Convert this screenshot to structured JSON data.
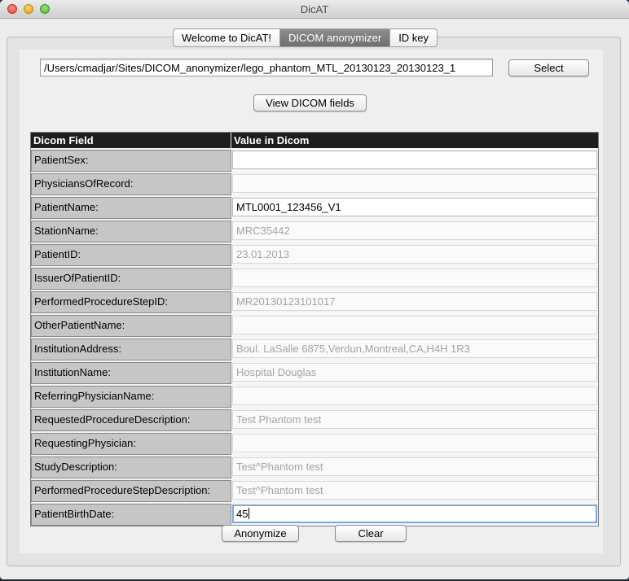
{
  "window": {
    "title": "DicAT"
  },
  "tabs": [
    {
      "label": "Welcome to DicAT!",
      "active": false
    },
    {
      "label": "DICOM anonymizer",
      "active": true
    },
    {
      "label": "ID key",
      "active": false
    }
  ],
  "file": {
    "path": "/Users/cmadjar/Sites/DICOM_anonymizer/lego_phantom_MTL_20130123_20130123_1",
    "select_label": "Select"
  },
  "view_fields_label": "View DICOM fields",
  "table": {
    "headers": [
      "Dicom Field",
      "Value in Dicom"
    ],
    "rows": [
      {
        "field": "PatientSex:",
        "value": "",
        "editable": true
      },
      {
        "field": "PhysiciansOfRecord:",
        "value": "",
        "editable": false
      },
      {
        "field": "PatientName:",
        "value": "MTL0001_123456_V1",
        "editable": true
      },
      {
        "field": "StationName:",
        "value": "MRC35442",
        "editable": false
      },
      {
        "field": "PatientID:",
        "value": "23.01.2013",
        "editable": false
      },
      {
        "field": "IssuerOfPatientID:",
        "value": "",
        "editable": false
      },
      {
        "field": "PerformedProcedureStepID:",
        "value": "MR20130123101017",
        "editable": false
      },
      {
        "field": "OtherPatientName:",
        "value": "",
        "editable": false
      },
      {
        "field": "InstitutionAddress:",
        "value": "Boul. LaSalle 6875,Verdun,Montreal,CA,H4H 1R3",
        "editable": false
      },
      {
        "field": "InstitutionName:",
        "value": "Hospital Douglas",
        "editable": false
      },
      {
        "field": "ReferringPhysicianName:",
        "value": "",
        "editable": false
      },
      {
        "field": "RequestedProcedureDescription:",
        "value": "Test Phantom test",
        "editable": false
      },
      {
        "field": "RequestingPhysician:",
        "value": "",
        "editable": false
      },
      {
        "field": "StudyDescription:",
        "value": "Test^Phantom test",
        "editable": false
      },
      {
        "field": "PerformedProcedureStepDescription:",
        "value": "Test^Phantom test",
        "editable": false
      },
      {
        "field": "PatientBirthDate:",
        "value": "45",
        "editable": true,
        "focused": true
      }
    ]
  },
  "buttons": {
    "anonymize": "Anonymize",
    "clear": "Clear"
  }
}
